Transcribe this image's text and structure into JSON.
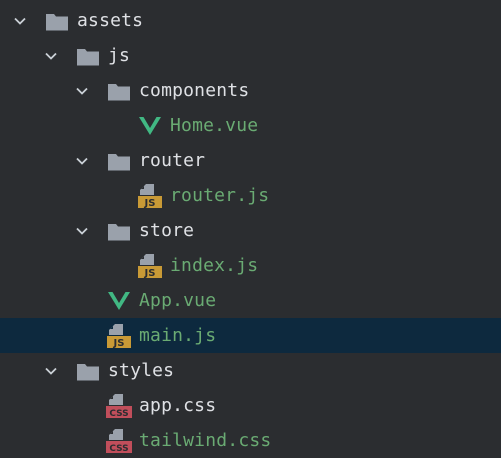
{
  "tree": {
    "assets": {
      "label": "assets",
      "icon": "folder-icon"
    },
    "js": {
      "label": "js",
      "icon": "folder-icon"
    },
    "components": {
      "label": "components",
      "icon": "folder-icon"
    },
    "home_vue": {
      "label": "Home.vue",
      "icon": "vue-file-icon"
    },
    "router": {
      "label": "router",
      "icon": "folder-icon"
    },
    "router_js": {
      "label": "router.js",
      "icon": "js-file-icon",
      "badge": "JS"
    },
    "store": {
      "label": "store",
      "icon": "folder-icon"
    },
    "index_js": {
      "label": "index.js",
      "icon": "js-file-icon",
      "badge": "JS"
    },
    "app_vue": {
      "label": "App.vue",
      "icon": "vue-file-icon"
    },
    "main_js": {
      "label": "main.js",
      "icon": "js-file-icon",
      "badge": "JS",
      "selected": true
    },
    "styles": {
      "label": "styles",
      "icon": "folder-icon"
    },
    "app_css": {
      "label": "app.css",
      "icon": "css-file-icon",
      "badge": "CSS"
    },
    "tailwind_css": {
      "label": "tailwind.css",
      "icon": "css-file-icon",
      "badge": "CSS"
    }
  },
  "colors": {
    "background": "#2b2d30",
    "selection": "#0d293e",
    "folder_text": "#dfe1e5",
    "file_text": "#6aab73",
    "folder_icon": "#9aa1ab",
    "vue_green": "#41b883",
    "js_badge": "#c99a36",
    "css_badge": "#c14e5b"
  }
}
